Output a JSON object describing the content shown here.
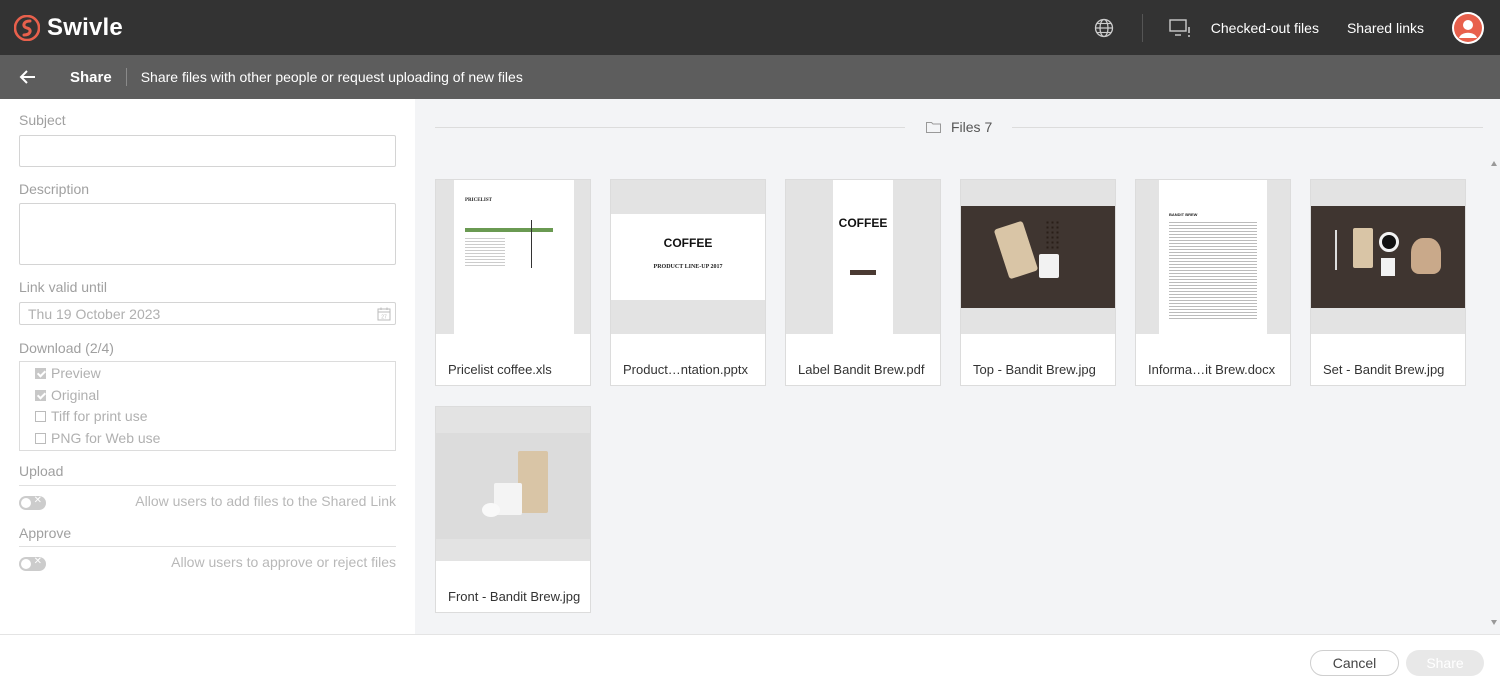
{
  "app": {
    "name": "Swivle",
    "brand_color": "#e8604c"
  },
  "topbar": {
    "icons": [
      "globe-icon",
      "monitor-alert-icon",
      "avatar-icon"
    ],
    "links": [
      "Checked-out files",
      "Shared links"
    ]
  },
  "subbar": {
    "title": "Share",
    "description": "Share files with other people or request uploading of new files"
  },
  "form": {
    "subject": {
      "label": "Subject",
      "value": ""
    },
    "description": {
      "label": "Description",
      "value": ""
    },
    "link_valid_until": {
      "label": "Link valid until",
      "value": "Thu 19 October 2023"
    },
    "download": {
      "label": "Download (2/4)",
      "options": [
        {
          "label": "Preview",
          "checked": true
        },
        {
          "label": "Original",
          "checked": true
        },
        {
          "label": "Tiff for print use",
          "checked": false
        },
        {
          "label": "PNG for Web use",
          "checked": false
        }
      ]
    },
    "upload": {
      "label": "Upload",
      "toggle_text": "Allow users to add files to the Shared Link",
      "enabled": false
    },
    "approve": {
      "label": "Approve",
      "toggle_text": "Allow users to approve or reject files",
      "enabled": false
    }
  },
  "files": {
    "header": "Files 7",
    "items": [
      {
        "name": "Pricelist coffee.xls",
        "thumb_text": "PRICELIST"
      },
      {
        "name": "Product…ntation.pptx",
        "thumb_text": "COFFEE",
        "thumb_sub": "PRODUCT LINE-UP 2017"
      },
      {
        "name": "Label Bandit Brew.pdf",
        "thumb_text": "COFFEE"
      },
      {
        "name": "Top - Bandit Brew.jpg"
      },
      {
        "name": "Informa…it Brew.docx",
        "thumb_text": "BANDIT BREW"
      },
      {
        "name": "Set - Bandit Brew.jpg"
      },
      {
        "name": "Front - Bandit Brew.jpg"
      }
    ]
  },
  "footer": {
    "cancel": "Cancel",
    "share": "Share"
  }
}
